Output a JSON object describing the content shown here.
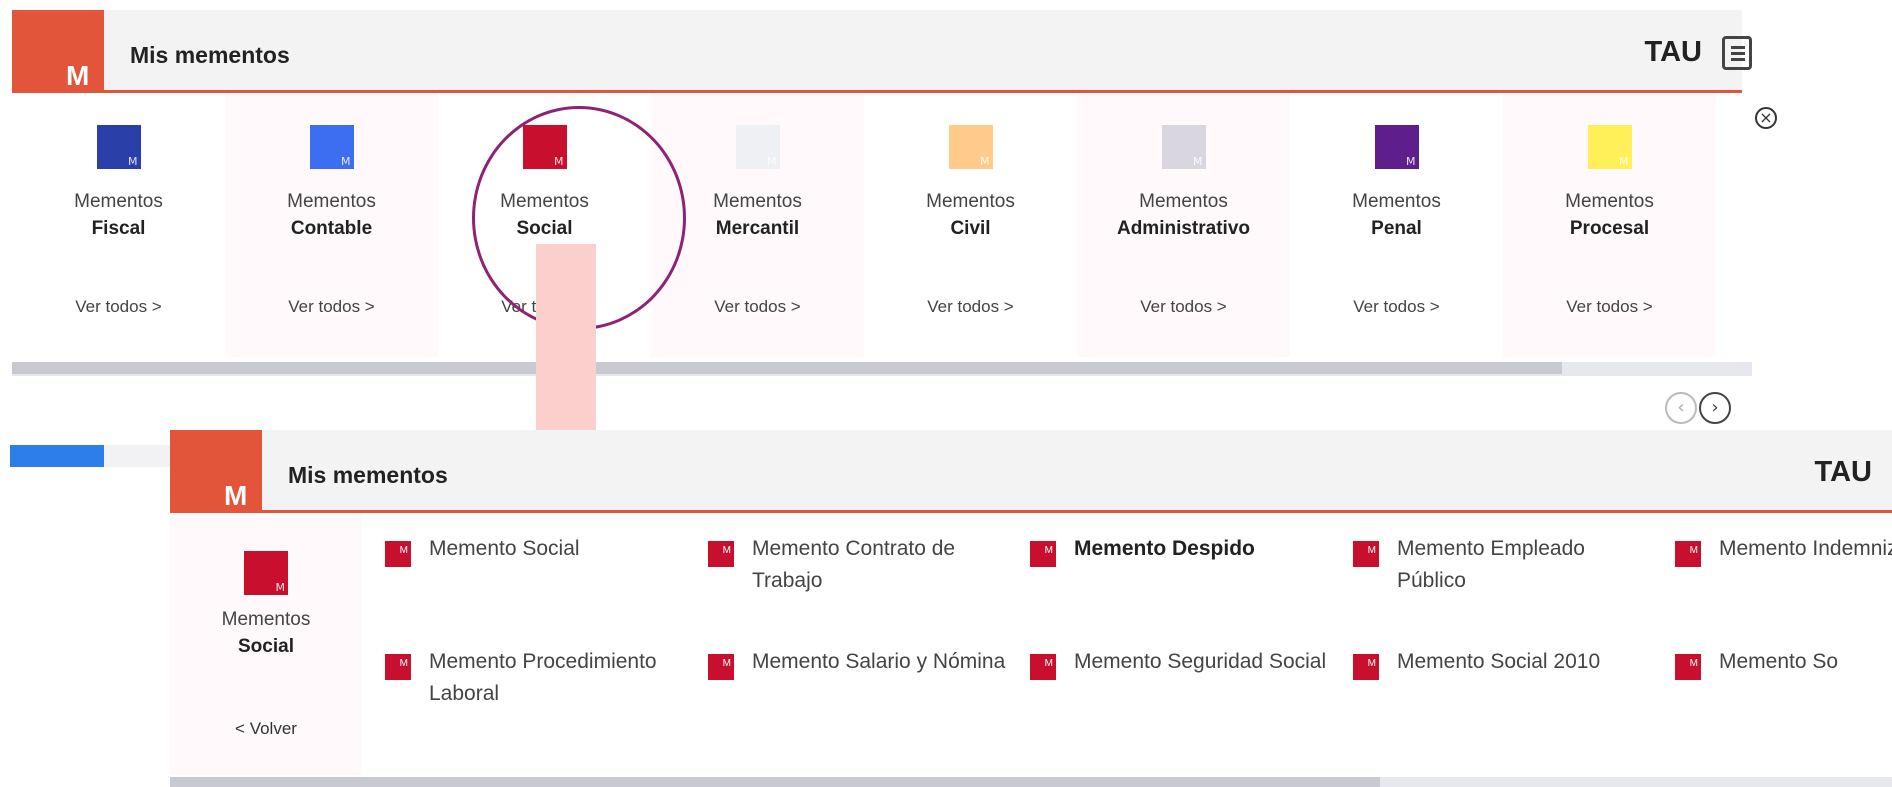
{
  "top_panel": {
    "logo": "M",
    "title": "Mis mementos",
    "tau": "TAU",
    "categories": [
      {
        "line1": "Mementos",
        "line2": "Fiscal",
        "more": "Ver todos >",
        "color": "#2a3fa8"
      },
      {
        "line1": "Mementos",
        "line2": "Contable",
        "more": "Ver todos >",
        "color": "#3d6df0"
      },
      {
        "line1": "Mementos",
        "line2": "Social",
        "more": "Ver todos >",
        "color": "#c8102e"
      },
      {
        "line1": "Mementos",
        "line2": "Mercantil",
        "more": "Ver todos >",
        "color": "#eef0f3"
      },
      {
        "line1": "Mementos",
        "line2": "Civil",
        "more": "Ver todos >",
        "color": "#ffca8a"
      },
      {
        "line1": "Mementos",
        "line2": "Administrativo",
        "more": "Ver todos >",
        "color": "#d9d6e0"
      },
      {
        "line1": "Mementos",
        "line2": "Penal",
        "more": "Ver todos >",
        "color": "#5e1f8c"
      },
      {
        "line1": "Mementos",
        "line2": "Procesal",
        "more": "Ver todos >",
        "color": "#fff05a"
      }
    ],
    "square_letter": "M"
  },
  "bottom_panel": {
    "logo": "M",
    "title": "Mis mementos",
    "tau": "TAU",
    "side": {
      "line1": "Mementos",
      "line2": "Social",
      "back": "< Volver",
      "color": "#c8102e"
    },
    "icon_letter": "M",
    "items": [
      {
        "label": "Memento Social"
      },
      {
        "label": "Memento Contrato de Trabajo"
      },
      {
        "label": "Memento Despido"
      },
      {
        "label": "Memento Empleado Público"
      },
      {
        "label": "Memento Indemnizacio"
      },
      {
        "label": "Memento Procedimiento Laboral"
      },
      {
        "label": "Memento Salario y Nómina"
      },
      {
        "label": "Memento Seguridad Social"
      },
      {
        "label": "Memento Social 2010"
      },
      {
        "label": "Memento So"
      }
    ]
  },
  "colors": {
    "accent": "#e2553b",
    "highlight_ring": "#8e2376",
    "arrow": "#fbd0cc",
    "icon_red": "#c8102e"
  }
}
